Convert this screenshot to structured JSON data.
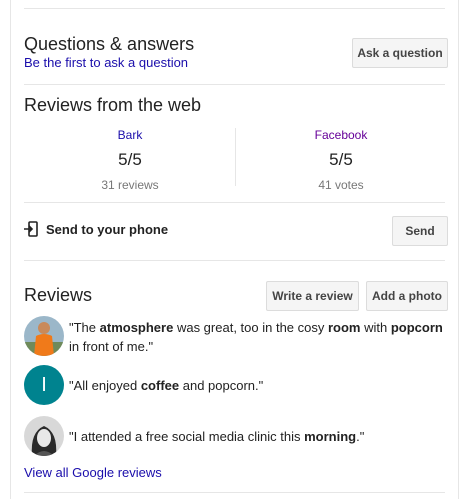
{
  "qa": {
    "title": "Questions & answers",
    "first_link": "Be the first to ask a question",
    "ask_button": "Ask a question"
  },
  "web_reviews": {
    "title": "Reviews from the web",
    "sources": [
      {
        "name": "Bark",
        "score": "5/5",
        "count": "31 reviews"
      },
      {
        "name": "Facebook",
        "score": "5/5",
        "count": "41 votes"
      }
    ]
  },
  "send": {
    "label": "Send to your phone",
    "button": "Send",
    "icon": "send-to-phone-icon"
  },
  "reviews": {
    "title": "Reviews",
    "write_button": "Write a review",
    "photo_button": "Add a photo",
    "items": [
      {
        "avatar": "photo-avatar-orange",
        "segments": [
          {
            "t": "\"The ",
            "b": false
          },
          {
            "t": "atmosphere",
            "b": true
          },
          {
            "t": " was great, too in the cosy ",
            "b": false
          },
          {
            "t": "room",
            "b": true
          },
          {
            "t": " with ",
            "b": false
          },
          {
            "t": "popcorn",
            "b": true
          },
          {
            "t": " in front of me.\"",
            "b": false
          }
        ]
      },
      {
        "avatar": "letter-avatar",
        "initial": "I",
        "avatar_color": "#00838f",
        "segments": [
          {
            "t": "\"All enjoyed ",
            "b": false
          },
          {
            "t": "coffee",
            "b": true
          },
          {
            "t": " and popcorn.\"",
            "b": false
          }
        ]
      },
      {
        "avatar": "photo-avatar-bw",
        "segments": [
          {
            "t": "\"I attended a free social media clinic this ",
            "b": false
          },
          {
            "t": "morning",
            "b": true
          },
          {
            "t": ".\"",
            "b": false
          }
        ]
      }
    ],
    "view_all": "View all Google reviews"
  }
}
